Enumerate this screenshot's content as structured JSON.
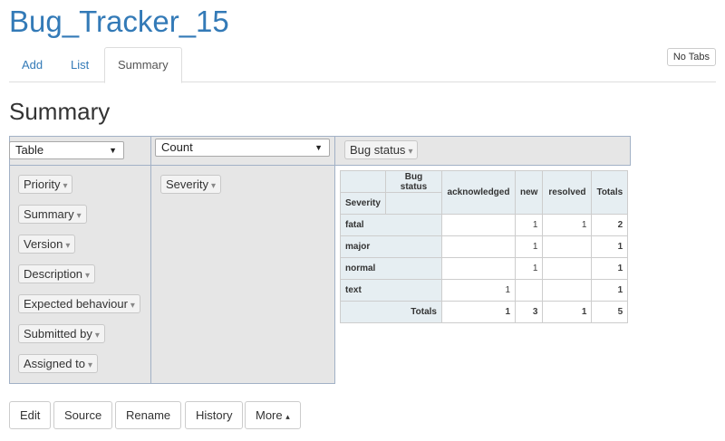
{
  "app": {
    "title": "Bug_Tracker_15"
  },
  "tabs": [
    {
      "label": "Add"
    },
    {
      "label": "List"
    },
    {
      "label": "Summary"
    }
  ],
  "no_tabs_label": "No Tabs",
  "section_title": "Summary",
  "pivot": {
    "renderer": "Table",
    "aggregator": "Count",
    "column_attr": "Bug status",
    "row_attr": "Severity",
    "unused_attrs": [
      "Priority",
      "Summary",
      "Version",
      "Description",
      "Expected behaviour",
      "Submitted by",
      "Assigned to"
    ],
    "table": {
      "col_header_label": "Bug status",
      "row_header_label": "Severity",
      "columns": [
        "acknowledged",
        "new",
        "resolved"
      ],
      "totals_label": "Totals",
      "rows": [
        {
          "label": "fatal",
          "cells": [
            "",
            "1",
            "1"
          ],
          "total": "2"
        },
        {
          "label": "major",
          "cells": [
            "",
            "1",
            ""
          ],
          "total": "1"
        },
        {
          "label": "normal",
          "cells": [
            "",
            "1",
            ""
          ],
          "total": "1"
        },
        {
          "label": "text",
          "cells": [
            "1",
            "",
            ""
          ],
          "total": "1"
        }
      ],
      "col_totals": [
        "1",
        "3",
        "1"
      ],
      "grand_total": "5"
    }
  },
  "actions": [
    "Edit",
    "Source",
    "Rename",
    "History",
    "More"
  ],
  "icons": {
    "dropdown": "▼",
    "filter": "▾",
    "more_caret": "▴"
  }
}
